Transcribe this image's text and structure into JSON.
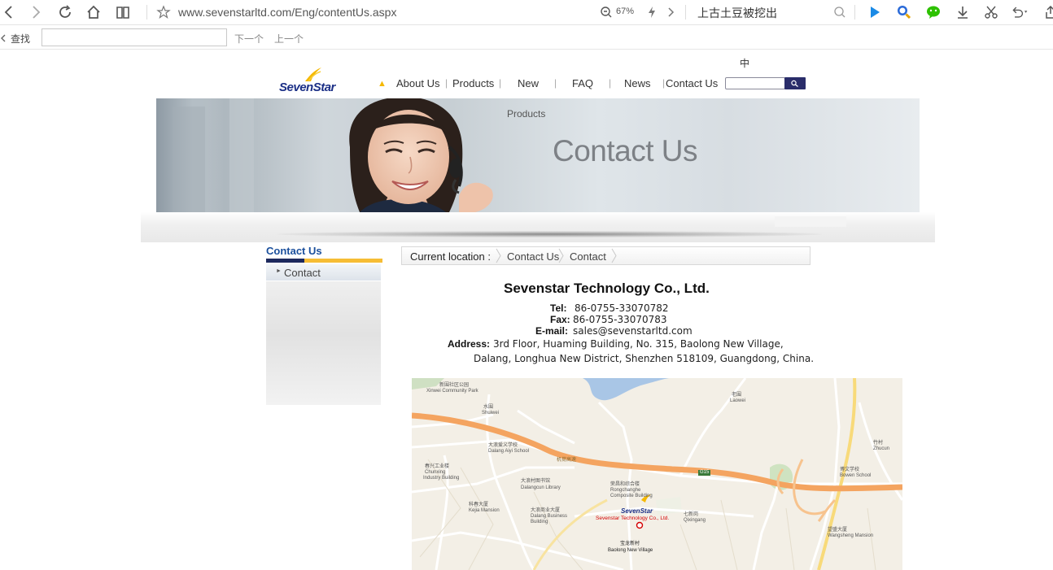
{
  "browser": {
    "url": "www.sevenstarltd.com/Eng/contentUs.aspx",
    "zoom": "67%",
    "search_query": "上古土豆被挖出"
  },
  "find_bar": {
    "label": "查找",
    "input_value": "",
    "next": "下一个",
    "prev": "上一个"
  },
  "site": {
    "lang": "中",
    "logo_text": "SevenStar",
    "nav": [
      "About Us",
      "Products",
      "New",
      "FAQ",
      "News",
      "Contact Us"
    ],
    "search_placeholder": ""
  },
  "banner": {
    "submenu": "Products",
    "title": "Contact Us"
  },
  "sidebar": {
    "title": "Contact Us",
    "items": [
      {
        "label": "Contact"
      }
    ]
  },
  "breadcrumb": {
    "prefix": "Current location :",
    "items": [
      "Contact Us",
      "Contact"
    ]
  },
  "contact": {
    "company": "Sevenstar Technology Co., Ltd.",
    "tel_label": "Tel:",
    "tel": "86-0755-33070782",
    "fax_label": "Fax:",
    "fax": "86-0755-33070783",
    "email_label": "E-mail:",
    "email": "sales@sevenstarltd.com",
    "address_label": "Address:",
    "address_line1": "3rd Floor,  Huaming Building, No. 315, Baolong New Village,",
    "address_line2": "Dalang, Longhua New District, Shenzhen 518109, Guangdong, China."
  },
  "map": {
    "labels": {
      "xinwei_cn": "新围社区公园",
      "xinwei_en": "Xinwei Community Park",
      "shuiwei_cn": "水围",
      "shuiwei_en": "Shuiwei",
      "laowei_cn": "老围",
      "laowei_en": "Laowei",
      "aiyi_cn": "大浪爱义学校",
      "aiyi_en": "Dalang Aiyi School",
      "chunxing_cn": "春兴工业楼",
      "chunxing_en1": "Chunxing",
      "chunxing_en2": "Industry Building",
      "library_cn": "大浪村图书馆",
      "library_en": "Dalangcun Library",
      "rongchang_cn": "荣昌和综合楼",
      "rongchang_en1": "Rongchanghe",
      "rongchang_en2": "Composite Building",
      "bowen_cn": "博文学校",
      "bowen_en": "Bowen School",
      "zhucun_cn": "竹村",
      "zhucun_en": "Zhucun",
      "kejia_cn": "科春大厦",
      "kejia_en": "Kejia Mansion",
      "business_cn": "大浪商业大厦",
      "business_en1": "Dalang Business",
      "business_en2": "Building",
      "qixin_cn": "七新岗",
      "qixin_en": "Qixingang",
      "wangsheng_cn": "望盛大厦",
      "wangsheng_en": "Wangsheng Mansion",
      "baolong_cn": "宝龙新村",
      "baolong_en": "Baolong New Village",
      "highway": "机荷高速",
      "road_badge": "G15",
      "marker_logo": "SevenStar",
      "marker_name": "Sevenstar Technology Co., Ltd."
    }
  },
  "colors": {
    "nav_dark": "#2a2d6a",
    "sidebar_title": "#1a4f9c",
    "accent_yellow": "#f6bd35",
    "highway": "#f4a460",
    "marker": "#d40000"
  }
}
